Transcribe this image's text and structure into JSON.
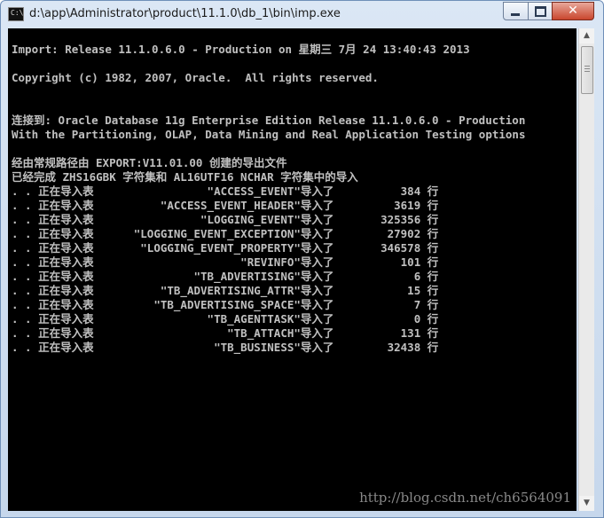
{
  "window": {
    "title": "d:\\app\\Administrator\\product\\11.1.0\\db_1\\bin\\imp.exe",
    "app_icon": "console-icon",
    "controls": {
      "minimize": "minimize-icon",
      "maximize": "maximize-icon",
      "close": "close-icon",
      "close_glyph": "✕"
    }
  },
  "console": {
    "lines": [
      "Import: Release 11.1.0.6.0 - Production on 星期三 7月 24 13:40:43 2013",
      "Copyright (c) 1982, 2007, Oracle.  All rights reserved.",
      "连接到: Oracle Database 11g Enterprise Edition Release 11.1.0.6.0 - Production",
      "With the Partitioning, OLAP, Data Mining and Real Application Testing options",
      "经由常规路径由 EXPORT:V11.01.00 创建的导出文件",
      "已经完成 ZHS16GBK 字符集和 AL16UTF16 NCHAR 字符集中的导入",
      ". . 正在导入表                 \"ACCESS_EVENT\"导入了          384 行",
      ". . 正在导入表          \"ACCESS_EVENT_HEADER\"导入了         3619 行",
      ". . 正在导入表                \"LOGGING_EVENT\"导入了       325356 行",
      ". . 正在导入表      \"LOGGING_EVENT_EXCEPTION\"导入了        27902 行",
      ". . 正在导入表       \"LOGGING_EVENT_PROPERTY\"导入了       346578 行",
      ". . 正在导入表                      \"REVINFO\"导入了          101 行",
      ". . 正在导入表               \"TB_ADVERTISING\"导入了            6 行",
      ". . 正在导入表          \"TB_ADVERTISING_ATTR\"导入了           15 行",
      ". . 正在导入表         \"TB_ADVERTISING_SPACE\"导入了            7 行",
      ". . 正在导入表                 \"TB_AGENTTASK\"导入了            0 行",
      ". . 正在导入表                    \"TB_ATTACH\"导入了          131 行",
      ". . 正在导入表                  \"TB_BUSINESS\"导入了        32438 行"
    ],
    "watermark": "http://blog.csdn.net/ch6564091"
  },
  "scrollbar": {
    "up_glyph": "▲",
    "down_glyph": "▼"
  },
  "colors": {
    "console_bg": "#000000",
    "console_text": "#c0c0c0",
    "close_button": "#c9462d"
  }
}
